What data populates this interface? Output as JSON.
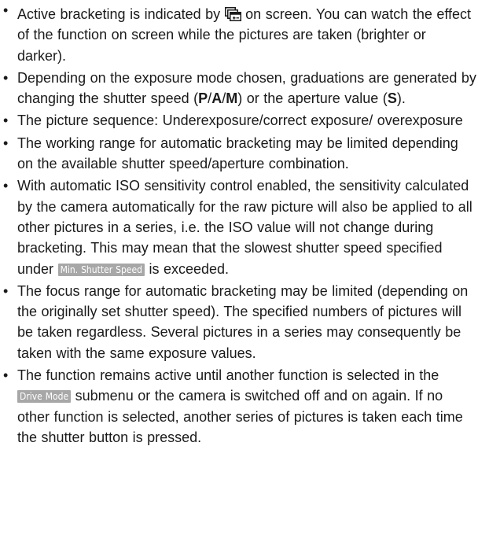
{
  "bullets": [
    {
      "part1": "Active bracketing is indicated by",
      "icon": "bracketing-icon",
      "part2": "on screen. You can watch the effect of the function on screen while the pictures are taken (brighter or darker)."
    },
    {
      "part1": "Depending on the exposure mode chosen, graduations are generated by changing the shutter speed (",
      "mode_p": "P",
      "mode_a": "A",
      "mode_m": "M",
      "part2": ") or the aperture value (",
      "mode_s": "S",
      "part3": ")."
    },
    {
      "text": "The picture sequence: Underexposure/correct exposure/ overexposure"
    },
    {
      "text": "The working range for automatic bracketing may be limited depending on the available shutter speed/aperture combination."
    },
    {
      "part1": "With automatic ISO sensitivity control enabled, the sensitivity calculated by the camera automatically for the raw picture will also be applied to all other pictures in a series, i.e. the ISO value will not change during bracketing. This may mean that the slowest shutter speed specified under",
      "menu_tag": "Min. Shutter Speed",
      "part2": "is exceeded."
    },
    {
      "text": "The focus range for automatic bracketing may be limited (depending on the originally set shutter speed). The specified numbers of pictures will be taken regardless. Several pictures in a series may consequently be taken with the same exposure values."
    },
    {
      "part1": "The function remains active until another function is selected in the",
      "menu_tag": "Drive Mode",
      "part2": "submenu or the camera is switched off and on again. If no other function is selected, another series of pictures is taken each time the shutter button is pressed."
    }
  ]
}
